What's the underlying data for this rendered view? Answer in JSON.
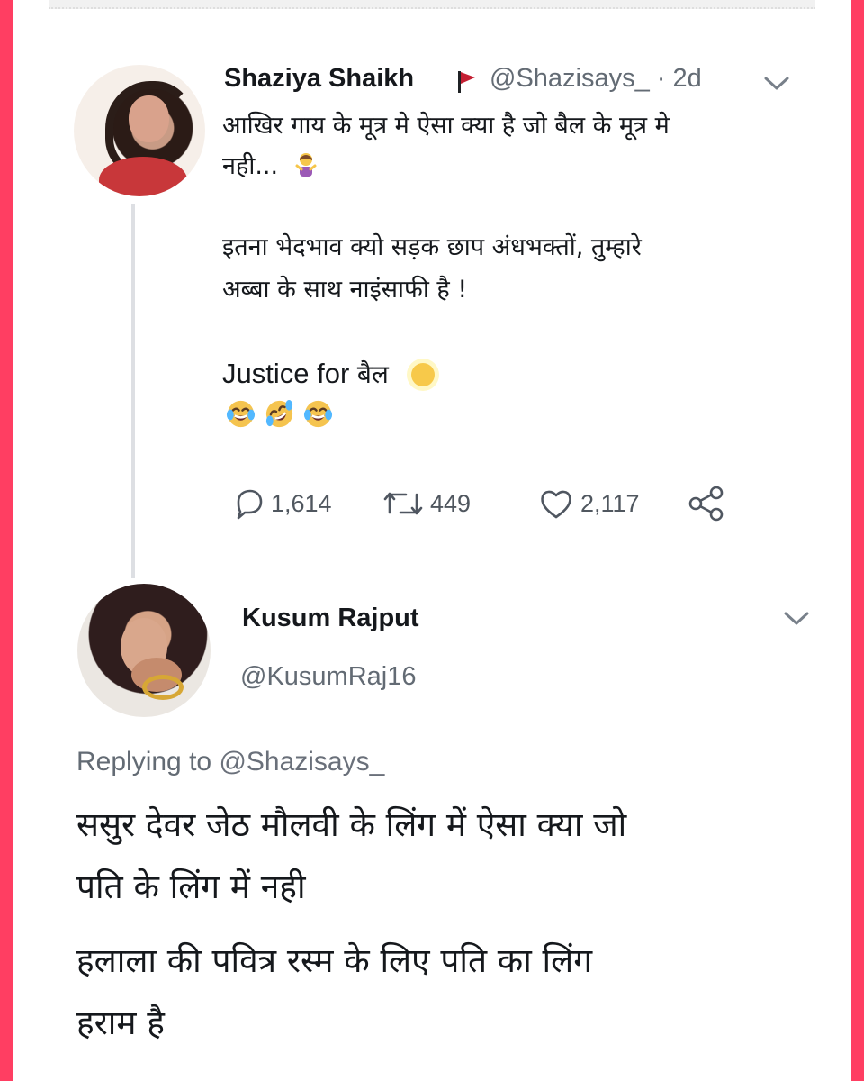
{
  "tweet": {
    "display_name": "Shaziya Shaikh",
    "handle_time": "@Shazisays_ · 2d",
    "text_lines": [
      "आखिर गाय के मूत्र मे ऐसा क्या है जो बैल के मूत्र मे",
      "नही...",
      "इतना भेदभाव क्यो सड़क छाप अंधभक्तों, तुम्हारे",
      "अब्बा के साथ नाइंसाफी है !"
    ],
    "justice_prefix": "Justice for",
    "justice_hindi": "बैल",
    "stats": {
      "replies": "1,614",
      "retweets": "449",
      "likes": "2,117"
    }
  },
  "reply": {
    "display_name": "Kusum Rajput",
    "handle": "@KusumRaj16",
    "replying_prefix": "Replying to",
    "replying_handle": "@Shazisays_",
    "text_lines": [
      "ससुर देवर जेठ मौलवी के लिंग में ऐसा क्या जो",
      "पति के लिंग में नही",
      "हलाला की पवित्र रस्म के लिए पति का लिंग",
      "हराम है"
    ]
  },
  "colors": {
    "border": "#ff3e62",
    "background": "#ffffff",
    "primary_text": "#15181c",
    "secondary_text": "#636b74",
    "flag": "#c42033",
    "emoji_yellow": "#f7c94a"
  },
  "icons": {
    "flag": "red-flag-icon",
    "chevron": "chevron-down-icon",
    "shrug": "person-shrugging-emoji",
    "sun": "sun-emoji",
    "laugh": "tears-of-joy-emoji",
    "rofl": "rolling-laughing-emoji",
    "reply": "reply-icon",
    "retweet": "retweet-icon",
    "like": "heart-icon",
    "share": "share-icon"
  }
}
